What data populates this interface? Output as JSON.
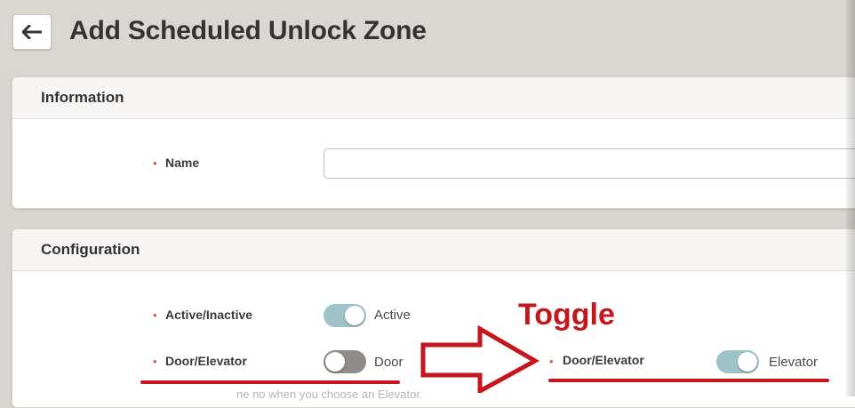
{
  "header": {
    "title": "Add Scheduled Unlock Zone",
    "back_icon": "arrow-left-icon"
  },
  "information": {
    "section_title": "Information",
    "name_label": "Name",
    "name_value": "",
    "name_placeholder": ""
  },
  "configuration": {
    "section_title": "Configuration",
    "active_label": "Active/Inactive",
    "active_state": "Active",
    "door_label": "Door/Elevator",
    "door_state": "Door",
    "elevator_label": "Door/Elevator",
    "elevator_state": "Elevator"
  },
  "annotation": {
    "toggle_text": "Toggle",
    "arrow_icon": "arrow-right-outline-icon"
  },
  "footer_hint": "ne no when you choose an Elevator.",
  "colors": {
    "accent_red": "#c4161c",
    "toggle_on": "#9fc2c8",
    "toggle_off": "#8f8c89",
    "required_mark": "#d9534f"
  },
  "required_mark": "•"
}
